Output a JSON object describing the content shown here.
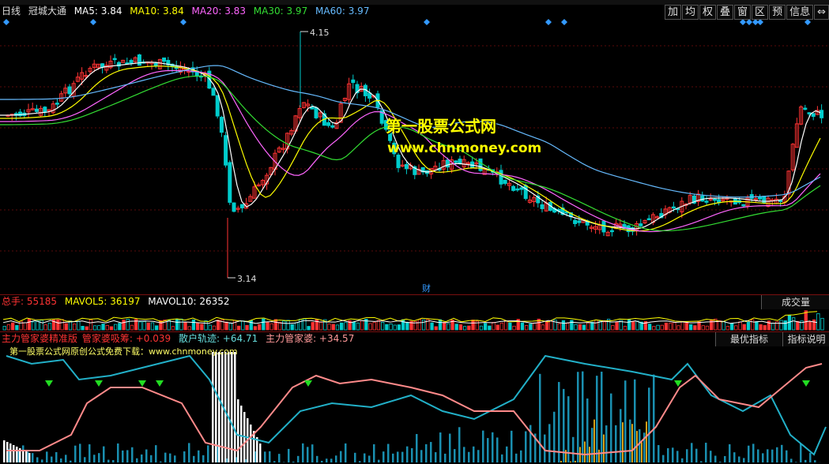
{
  "main": {
    "period": "日线",
    "stock_name": "冠城大通",
    "ma": [
      {
        "label": "MA5: 3.84",
        "color": "#ffffff"
      },
      {
        "label": "MA10: 3.84",
        "color": "#ffff00"
      },
      {
        "label": "MA20: 3.83",
        "color": "#ff66ff"
      },
      {
        "label": "MA30: 3.97",
        "color": "#33dd33"
      },
      {
        "label": "MA60: 3.97",
        "color": "#66bbff"
      }
    ],
    "buttons": [
      "加",
      "均",
      "权",
      "叠",
      "窗",
      "区",
      "预",
      "信息",
      "⇔"
    ],
    "high_label": "4.15",
    "low_label": "3.14",
    "cai_marker": "财",
    "watermark_title": "第一股票公式网",
    "watermark_url": "www.chnmoney.com"
  },
  "volume": {
    "total": "总手: 55185",
    "mavol5": "MAVOL5: 36197",
    "mavol10": "MAVOL10: 26352",
    "dropdown": "成交量"
  },
  "indicator": {
    "name": "主力管家婆精准版",
    "line1": "管家婆吸筹: +0.039",
    "line2": "散户轨迹: +64.71",
    "line3": "主力管家婆: +34.57",
    "note": "第一股票公式网原创公式免费下载：www.chnmoney.com",
    "btn_best": "最优指标",
    "btn_help": "指标说明"
  },
  "colors": {
    "up": "#ff3333",
    "down": "#00cccc",
    "diamond": "#3399ff",
    "grid": "#5a0a0a"
  }
}
